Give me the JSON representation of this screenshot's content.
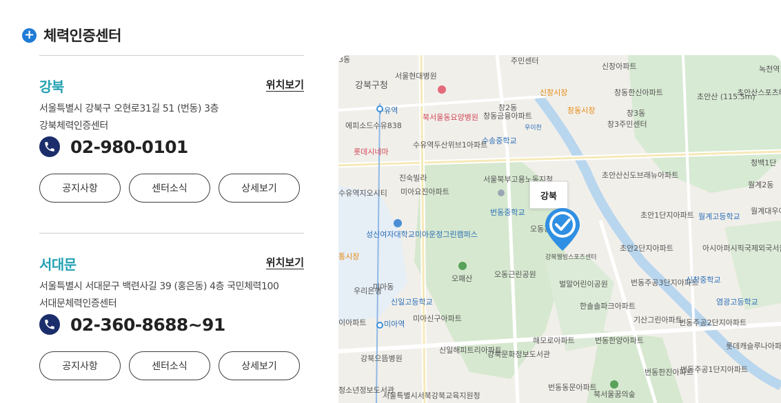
{
  "section": {
    "title": "체력인증센터"
  },
  "centers": [
    {
      "name": "강북",
      "location_link": "위치보기",
      "address_line1": "서울특별시 강북구 오현로31길 51 (번동) 3층",
      "address_line2": "강북체력인증센터",
      "phone": "02-980-0101",
      "buttons": [
        "공지사항",
        "센터소식",
        "상세보기"
      ]
    },
    {
      "name": "서대문",
      "location_link": "위치보기",
      "address_line1": "서울특별시 서대문구 백련사길 39 (홍은동) 4층 국민체력100",
      "address_line2": "서대문체력인증센터",
      "phone": "02-360-8688~91",
      "buttons": [
        "공지사항",
        "센터소식",
        "상세보기"
      ]
    }
  ],
  "map": {
    "marker_label": "강북",
    "colors": {
      "accent_blue": "#1f7bd6",
      "name_teal": "#21a0b2",
      "phone_navy": "#1b2e6b",
      "marker_blue": "#2f8fe3"
    },
    "labels": {
      "l1": "주민센터",
      "l2": "신창아파트",
      "l3": "녹천역",
      "l4": "서울현대병원",
      "l5": "강북구청",
      "l6": "신창시장",
      "l7": "창동한신아파트",
      "l8": "초안산 (115.5m)",
      "l9": "초안산스포츠타운",
      "l10": "수유역",
      "l11": "북서울동요양병원",
      "l12": "창동금융아파트",
      "l13": "창동시장",
      "l14": "창3동",
      "l15": "창3주민센터",
      "l16": "에피소드수유838",
      "l17": "수송중학교",
      "l18": "롯데시네마",
      "l19": "수유역두산위브1아파트",
      "l20": "청백1단",
      "l21": "진숙빌라",
      "l22": "서울북부고용노동지청",
      "l23": "초안산신도브래뉴아파트",
      "l24": "월계2동",
      "l25": "미아요진아파트",
      "l26": "수유역지오시티",
      "l27": "번동중학교",
      "l28": "초안1단지아파트",
      "l29": "월계고등학교",
      "l30": "월계대우아파트",
      "l31": "오동홍타운",
      "l32": "성신여자대학교미아운정그린캠퍼스",
      "l33": "초안2단지아파트",
      "l34": "아시아퍼시픽국제외국서울캠퍼스",
      "l35": "강북웰빙스포츠센터",
      "l36": "오패산",
      "l37": "오동근린공원",
      "l38": "벌말어린이공원",
      "l39": "번동주공3단지아파트",
      "l40": "신창중학교",
      "l41": "우리은행",
      "l42": "미아동",
      "l43": "신일고등학교",
      "l44": "염광고등학교",
      "l45": "한솔솔파크아파트",
      "l46": "기산그린아파트",
      "l47": "번동주공2단지아파트",
      "l48": "미아신구아파트",
      "l49": "미아역",
      "l50": "해모로아파트",
      "l51": "롯데캐슬루나아파트",
      "l52": "신일해피트리아파트",
      "l53": "번동한양아파트",
      "l54": "강북문화정보도서관",
      "l55": "강북으뜸병원",
      "l56": "번동한진아파트",
      "l57": "번동주공1단지아파트",
      "l58": "번동동문아파트",
      "l59": "북서울꿈의숲",
      "l60": "서울특별시서북강북교육지원청",
      "l61": "청소년정보도서관",
      "l62": "통시장",
      "l63": "이아파트",
      "l64": "3동",
      "l65": "우이천",
      "l66": "창2동"
    }
  }
}
